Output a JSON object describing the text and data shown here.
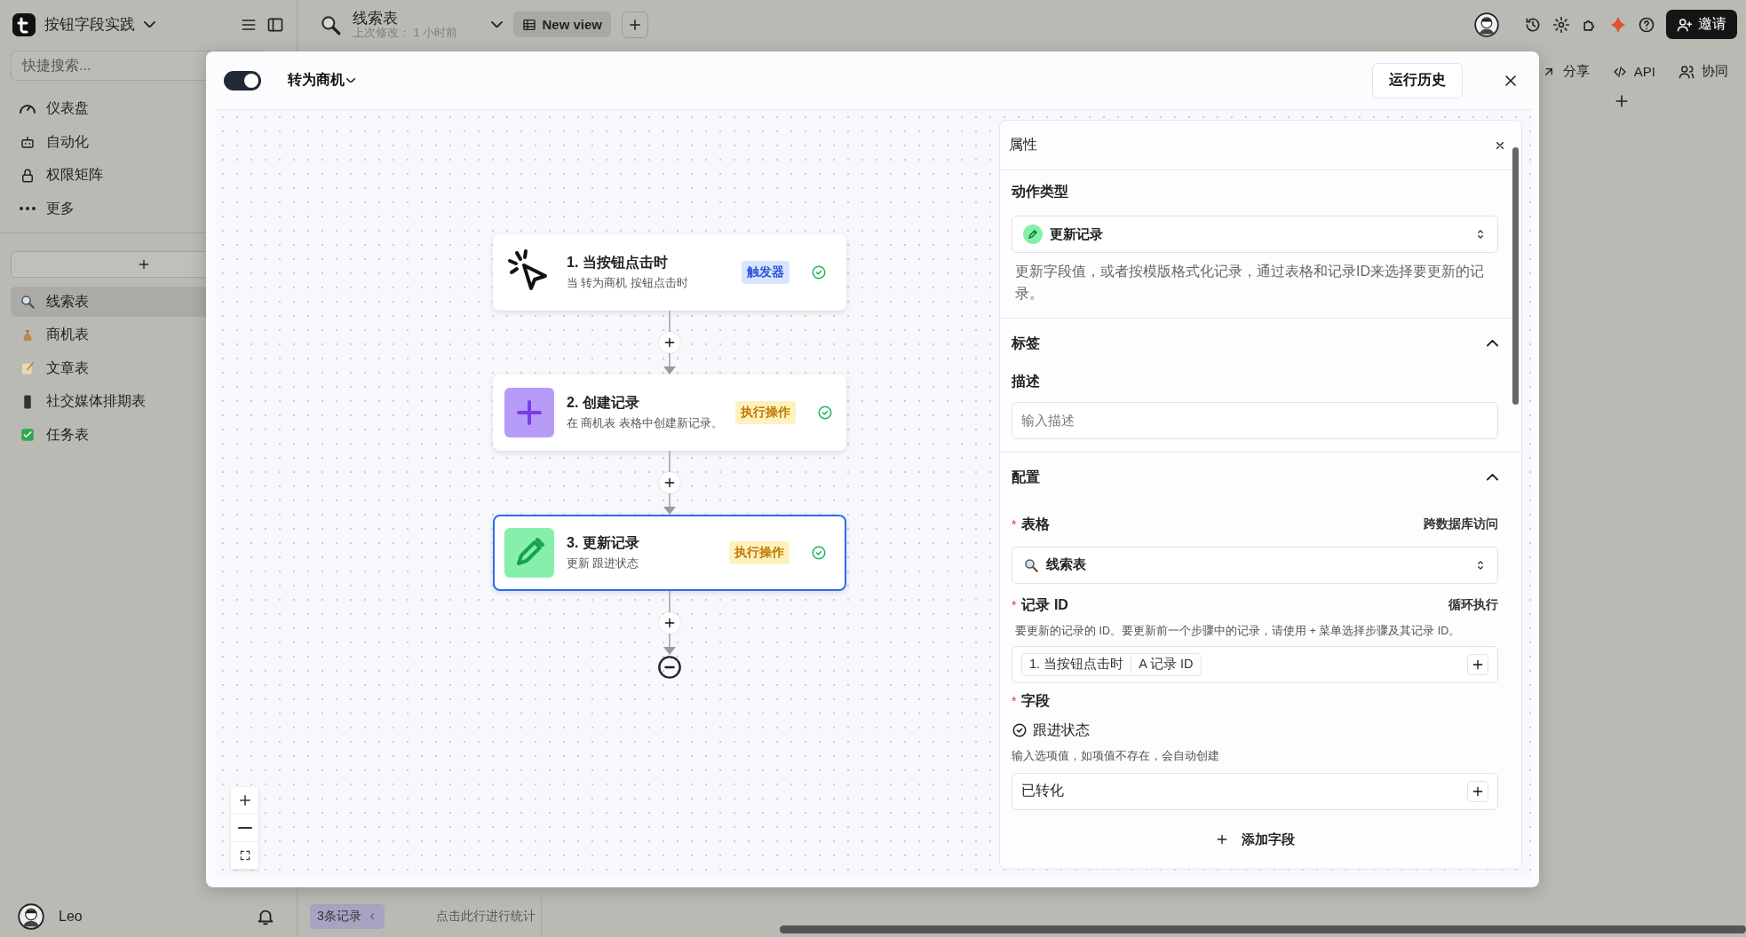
{
  "app": {
    "name": "按钮字段实践"
  },
  "topbar": {
    "table_name": "线索表",
    "last_modified": "上次修改：  1 小时前",
    "view_button": "New view",
    "invite_button": "邀请"
  },
  "sidebar": {
    "search_placeholder": "快捷搜索...",
    "nav_items": [
      "仪表盘",
      "自动化",
      "权限矩阵",
      "更多"
    ],
    "tables": [
      {
        "label": "线索表",
        "selected": true
      },
      {
        "label": "商机表",
        "selected": false
      },
      {
        "label": "文章表",
        "selected": false
      },
      {
        "label": "社交媒体排期表",
        "selected": false
      },
      {
        "label": "任务表",
        "selected": false
      }
    ],
    "user": "Leo"
  },
  "main_toolbar": [
    "分享",
    "API",
    "协同"
  ],
  "status_bar": {
    "record_count": "3条记录",
    "summary_hint": "点击此行进行统计"
  },
  "modal": {
    "enabled": true,
    "title": "转为商机",
    "history_button": "运行历史",
    "steps": [
      {
        "kind": "trigger",
        "title": "1. 当按钮点击时",
        "subtitle": "当 转为商机 按钮点击时",
        "badge": "触发器",
        "selected": false
      },
      {
        "kind": "action",
        "title": "2. 创建记录",
        "subtitle": "在 商机表 表格中创建新记录。",
        "badge": "执行操作",
        "selected": false
      },
      {
        "kind": "action",
        "title": "3. 更新记录",
        "subtitle": "更新 跟进状态",
        "badge": "执行操作",
        "selected": true
      }
    ],
    "properties": {
      "title": "属性",
      "action_type_label": "动作类型",
      "action_type": "更新记录",
      "action_description": "更新字段值，或者按模版格式化记录，通过表格和记录ID来选择要更新的记录。",
      "sections": [
        {
          "title": "标签",
          "expanded": true
        },
        {
          "title": "配置",
          "expanded": true
        }
      ],
      "description_label": "描述",
      "description_placeholder": "输入描述",
      "table_required": "*",
      "table_label": "表格",
      "table_link": "跨数据库访问",
      "table_value": "线索表",
      "record_id_required": "*",
      "record_id_label": "记录 ID",
      "record_id_link": "循环执行",
      "record_id_hint": "要更新的记录的 ID。要更新前一个步骤中的记录，请使用 + 菜单选择步骤及其记录 ID。",
      "record_token": [
        "1. 当按钮点击时",
        "A 记录 ID"
      ],
      "fields_required": "*",
      "fields_label": "字段",
      "field_name": "跟进状态",
      "field_hint": "输入选项值，如项值不存在，会自动创建",
      "field_value": "已转化",
      "add_field_button": "添加字段"
    }
  }
}
